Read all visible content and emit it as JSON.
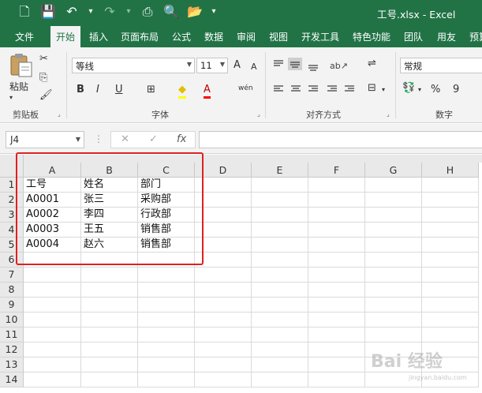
{
  "window": {
    "title": "工号.xlsx - Excel"
  },
  "qat": {
    "new": "🗋",
    "save": "💾",
    "undo": "↶",
    "undo_arrow": "▾",
    "redo": "↷",
    "redo_arrow": "▾",
    "print_preview": "⎙",
    "preview": "🔍",
    "open": "📂",
    "customize": "▾"
  },
  "tabs": [
    {
      "label": "文件"
    },
    {
      "label": "开始"
    },
    {
      "label": "插入"
    },
    {
      "label": "页面布局"
    },
    {
      "label": "公式"
    },
    {
      "label": "数据"
    },
    {
      "label": "审阅"
    },
    {
      "label": "视图"
    },
    {
      "label": "开发工具"
    },
    {
      "label": "特色功能"
    },
    {
      "label": "团队"
    },
    {
      "label": "用友"
    },
    {
      "label": "预算"
    }
  ],
  "active_tab": "开始",
  "ribbon": {
    "clipboard": {
      "label": "剪贴板",
      "paste": "粘贴",
      "cut": "✂",
      "copy": "⎘",
      "format_painter": "🖌"
    },
    "font": {
      "label": "字体",
      "name": "等线",
      "size": "11",
      "grow": "A",
      "shrink": "A",
      "bold": "B",
      "italic": "I",
      "underline": "U",
      "borders": "⊞",
      "fill": "◆",
      "color": "A",
      "wen": "wén"
    },
    "alignment": {
      "label": "对齐方式",
      "wrap": "⇌",
      "merge": "⊟"
    },
    "number": {
      "label": "数字",
      "format": "常规",
      "currency": "💱",
      "percent": "%",
      "comma": "9"
    },
    "launcher": "⌟"
  },
  "formula_bar": {
    "name_box": "J4",
    "dots": "⋮",
    "cancel": "✕",
    "enter": "✓",
    "fx": "fx",
    "content": ""
  },
  "sheet": {
    "columns": [
      "A",
      "B",
      "C",
      "D",
      "E",
      "F",
      "G",
      "H"
    ],
    "rows": [
      "1",
      "2",
      "3",
      "4",
      "5",
      "6",
      "7",
      "8",
      "9",
      "10",
      "11",
      "12",
      "13",
      "14"
    ],
    "cells": [
      [
        "工号",
        "姓名",
        "部门"
      ],
      [
        "A0001",
        "张三",
        "采购部"
      ],
      [
        "A0002",
        "李四",
        "行政部"
      ],
      [
        "A0003",
        "王五",
        "销售部"
      ],
      [
        "A0004",
        "赵六",
        "销售部"
      ]
    ],
    "selected_cell": "J4"
  },
  "annotation": {
    "color": "#e02020"
  },
  "watermark": {
    "text": "Bai 经验",
    "sub": "jingyan.baidu.com"
  },
  "colors": {
    "accent": "#217346",
    "ribbon_bg": "#f3f3f3"
  }
}
